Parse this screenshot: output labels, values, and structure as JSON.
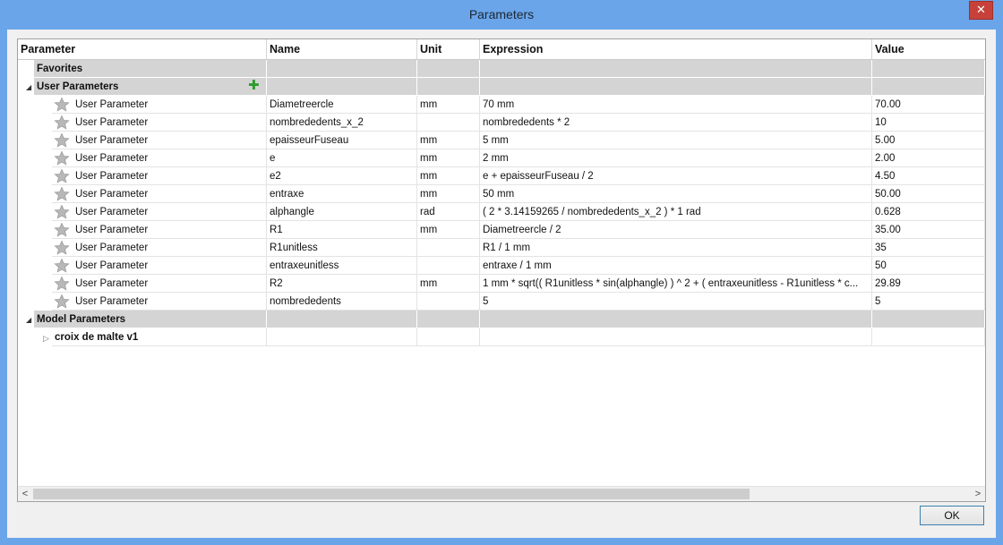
{
  "window": {
    "title": "Parameters",
    "close_glyph": "✕"
  },
  "columns": [
    {
      "key": "parameter",
      "label": "Parameter"
    },
    {
      "key": "name",
      "label": "Name"
    },
    {
      "key": "unit",
      "label": "Unit"
    },
    {
      "key": "expression",
      "label": "Expression"
    },
    {
      "key": "value",
      "label": "Value"
    }
  ],
  "groups": {
    "favorites": "Favorites",
    "user_parameters": "User Parameters",
    "model_parameters": "Model Parameters",
    "model_item": "croix de malte v1"
  },
  "icons": {
    "star": "star-icon",
    "add": "add-parameter-icon"
  },
  "colors": {
    "accent_add": "#2d9b2d",
    "group_row": "#d4d4d4"
  },
  "user_params": [
    {
      "type": "User Parameter",
      "name": "Diametreercle",
      "unit": "mm",
      "expression": "70 mm",
      "value": "70.00"
    },
    {
      "type": "User Parameter",
      "name": "nombrededents_x_2",
      "unit": "",
      "expression": "nombrededents * 2",
      "value": "10"
    },
    {
      "type": "User Parameter",
      "name": "epaisseurFuseau",
      "unit": "mm",
      "expression": "5 mm",
      "value": "5.00"
    },
    {
      "type": "User Parameter",
      "name": "e",
      "unit": "mm",
      "expression": "2 mm",
      "value": "2.00"
    },
    {
      "type": "User Parameter",
      "name": "e2",
      "unit": "mm",
      "expression": "e + epaisseurFuseau / 2",
      "value": "4.50"
    },
    {
      "type": "User Parameter",
      "name": "entraxe",
      "unit": "mm",
      "expression": "50 mm",
      "value": "50.00"
    },
    {
      "type": "User Parameter",
      "name": "alphangle",
      "unit": "rad",
      "expression": "( 2 * 3.14159265 / nombrededents_x_2 ) * 1 rad",
      "value": "0.628"
    },
    {
      "type": "User Parameter",
      "name": "R1",
      "unit": "mm",
      "expression": "Diametreercle / 2",
      "value": "35.00"
    },
    {
      "type": "User Parameter",
      "name": "R1unitless",
      "unit": "",
      "expression": "R1 / 1 mm",
      "value": "35"
    },
    {
      "type": "User Parameter",
      "name": "entraxeunitless",
      "unit": "",
      "expression": "entraxe / 1 mm",
      "value": "50"
    },
    {
      "type": "User Parameter",
      "name": "R2",
      "unit": "mm",
      "expression": "1 mm * sqrt(( R1unitless * sin(alphangle) ) ^ 2 + ( entraxeunitless - R1unitless * c...",
      "value": "29.89"
    },
    {
      "type": "User Parameter",
      "name": "nombrededents",
      "unit": "",
      "expression": "5",
      "value": "5"
    }
  ],
  "buttons": {
    "ok": "OK"
  },
  "scrollbar": {
    "left_arrow": "<",
    "right_arrow": ">"
  }
}
